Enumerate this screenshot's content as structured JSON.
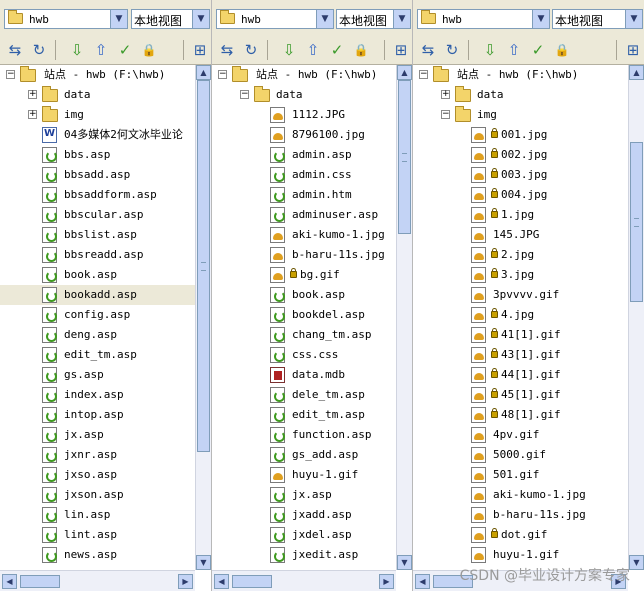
{
  "watermark": "CSDN @毕业设计方案专家",
  "colors": {
    "toolbar_bg": "#ece9d8",
    "scroll_btn": "#c3d3f5",
    "highlight_row": "#ece9d8"
  },
  "panels": [
    {
      "site": "hwb",
      "view": "本地视图",
      "toolbar_icons": [
        "connect-icon",
        "refresh-icon",
        "get-icon",
        "put-icon",
        "check-out-icon",
        "check-in-icon",
        "expand-icon"
      ],
      "root_label": "站点 - hwb (F:\\hwb)",
      "items": [
        {
          "type": "folder",
          "label": "data",
          "level": 1,
          "expander": "+"
        },
        {
          "type": "folder",
          "label": "img",
          "level": 1,
          "expander": "+"
        },
        {
          "type": "doc",
          "label": "04多媒体2何文冰毕业论",
          "level": 1
        },
        {
          "type": "asp",
          "label": "bbs.asp",
          "level": 1
        },
        {
          "type": "asp",
          "label": "bbsadd.asp",
          "level": 1
        },
        {
          "type": "asp",
          "label": "bbsaddform.asp",
          "level": 1
        },
        {
          "type": "asp",
          "label": "bbscular.asp",
          "level": 1
        },
        {
          "type": "asp",
          "label": "bbslist.asp",
          "level": 1
        },
        {
          "type": "asp",
          "label": "bbsreadd.asp",
          "level": 1
        },
        {
          "type": "asp",
          "label": "book.asp",
          "level": 1
        },
        {
          "type": "asp",
          "label": "bookadd.asp",
          "level": 1,
          "highlight": true
        },
        {
          "type": "asp",
          "label": "config.asp",
          "level": 1
        },
        {
          "type": "asp",
          "label": "deng.asp",
          "level": 1
        },
        {
          "type": "asp",
          "label": "edit_tm.asp",
          "level": 1
        },
        {
          "type": "asp",
          "label": "gs.asp",
          "level": 1
        },
        {
          "type": "asp",
          "label": "index.asp",
          "level": 1
        },
        {
          "type": "asp",
          "label": "intop.asp",
          "level": 1
        },
        {
          "type": "asp",
          "label": "jx.asp",
          "level": 1
        },
        {
          "type": "asp",
          "label": "jxnr.asp",
          "level": 1
        },
        {
          "type": "asp",
          "label": "jxso.asp",
          "level": 1
        },
        {
          "type": "asp",
          "label": "jxson.asp",
          "level": 1
        },
        {
          "type": "asp",
          "label": "lin.asp",
          "level": 1
        },
        {
          "type": "asp",
          "label": "lint.asp",
          "level": 1
        },
        {
          "type": "asp",
          "label": "news.asp",
          "level": 1
        }
      ]
    },
    {
      "site": "hwb",
      "view": "本地视图",
      "toolbar_icons": [
        "connect-icon",
        "refresh-icon",
        "get-icon",
        "put-icon",
        "check-out-icon",
        "check-in-icon",
        "expand-icon"
      ],
      "root_label": "站点 - hwb (F:\\hwb)",
      "items": [
        {
          "type": "folder",
          "label": "data",
          "level": 1,
          "expander": "-"
        },
        {
          "type": "img",
          "label": "1112.JPG",
          "level": 2
        },
        {
          "type": "img",
          "label": "8796100.jpg",
          "level": 2
        },
        {
          "type": "asp",
          "label": "admin.asp",
          "level": 2
        },
        {
          "type": "asp",
          "label": "admin.css",
          "level": 2
        },
        {
          "type": "asp",
          "label": "admin.htm",
          "level": 2
        },
        {
          "type": "asp",
          "label": "adminuser.asp",
          "level": 2
        },
        {
          "type": "img",
          "label": "aki-kumo-1.jpg",
          "level": 2
        },
        {
          "type": "img",
          "label": "b-haru-11s.jpg",
          "level": 2
        },
        {
          "type": "img",
          "label": "bg.gif",
          "level": 2,
          "locked": true
        },
        {
          "type": "asp",
          "label": "book.asp",
          "level": 2
        },
        {
          "type": "asp",
          "label": "bookdel.asp",
          "level": 2
        },
        {
          "type": "asp",
          "label": "chang_tm.asp",
          "level": 2
        },
        {
          "type": "asp",
          "label": "css.css",
          "level": 2
        },
        {
          "type": "mdb",
          "label": "data.mdb",
          "level": 2
        },
        {
          "type": "asp",
          "label": "dele_tm.asp",
          "level": 2
        },
        {
          "type": "asp",
          "label": "edit_tm.asp",
          "level": 2
        },
        {
          "type": "asp",
          "label": "function.asp",
          "level": 2
        },
        {
          "type": "asp",
          "label": "gs_add.asp",
          "level": 2
        },
        {
          "type": "img",
          "label": "huyu-1.gif",
          "level": 2
        },
        {
          "type": "asp",
          "label": "jx.asp",
          "level": 2
        },
        {
          "type": "asp",
          "label": "jxadd.asp",
          "level": 2
        },
        {
          "type": "asp",
          "label": "jxdel.asp",
          "level": 2
        },
        {
          "type": "asp",
          "label": "jxedit.asp",
          "level": 2
        }
      ]
    },
    {
      "site": "hwb",
      "view": "本地视图",
      "toolbar_icons": [
        "connect-icon",
        "refresh-icon",
        "get-icon",
        "put-icon",
        "check-out-icon",
        "check-in-icon",
        "expand-icon"
      ],
      "root_label": "站点 - hwb (F:\\hwb)",
      "items": [
        {
          "type": "folder",
          "label": "data",
          "level": 1,
          "expander": "+"
        },
        {
          "type": "folder",
          "label": "img",
          "level": 1,
          "expander": "-"
        },
        {
          "type": "img",
          "label": "001.jpg",
          "level": 2,
          "locked": true
        },
        {
          "type": "img",
          "label": "002.jpg",
          "level": 2,
          "locked": true
        },
        {
          "type": "img",
          "label": "003.jpg",
          "level": 2,
          "locked": true
        },
        {
          "type": "img",
          "label": "004.jpg",
          "level": 2,
          "locked": true
        },
        {
          "type": "img",
          "label": "1.jpg",
          "level": 2,
          "locked": true
        },
        {
          "type": "img",
          "label": "145.JPG",
          "level": 2
        },
        {
          "type": "img",
          "label": "2.jpg",
          "level": 2,
          "locked": true
        },
        {
          "type": "img",
          "label": "3.jpg",
          "level": 2,
          "locked": true
        },
        {
          "type": "img",
          "label": "3pvvvv.gif",
          "level": 2
        },
        {
          "type": "img",
          "label": "4.jpg",
          "level": 2,
          "locked": true
        },
        {
          "type": "img",
          "label": "41[1].gif",
          "level": 2,
          "locked": true
        },
        {
          "type": "img",
          "label": "43[1].gif",
          "level": 2,
          "locked": true
        },
        {
          "type": "img",
          "label": "44[1].gif",
          "level": 2,
          "locked": true
        },
        {
          "type": "img",
          "label": "45[1].gif",
          "level": 2,
          "locked": true
        },
        {
          "type": "img",
          "label": "48[1].gif",
          "level": 2,
          "locked": true
        },
        {
          "type": "img",
          "label": "4pv.gif",
          "level": 2
        },
        {
          "type": "img",
          "label": "5000.gif",
          "level": 2
        },
        {
          "type": "img",
          "label": "501.gif",
          "level": 2
        },
        {
          "type": "img",
          "label": "aki-kumo-1.jpg",
          "level": 2
        },
        {
          "type": "img",
          "label": "b-haru-11s.jpg",
          "level": 2
        },
        {
          "type": "img",
          "label": "dot.gif",
          "level": 2,
          "locked": true
        },
        {
          "type": "img",
          "label": "huyu-1.gif",
          "level": 2
        }
      ]
    }
  ]
}
